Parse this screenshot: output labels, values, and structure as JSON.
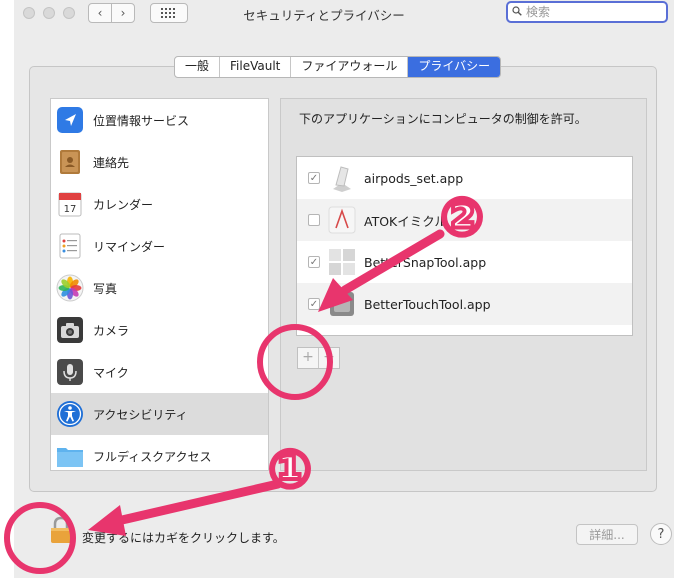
{
  "window": {
    "title": "セキュリティとプライバシー",
    "search_placeholder": "検索"
  },
  "tabs": [
    {
      "label": "一般",
      "active": false
    },
    {
      "label": "FileVault",
      "active": false
    },
    {
      "label": "ファイアウォール",
      "active": false
    },
    {
      "label": "プライバシー",
      "active": true
    }
  ],
  "sidebar": {
    "items": [
      {
        "label": "位置情報サービス",
        "icon": "location-arrow-icon"
      },
      {
        "label": "連絡先",
        "icon": "contacts-book-icon"
      },
      {
        "label": "カレンダー",
        "icon": "calendar-icon"
      },
      {
        "label": "リマインダー",
        "icon": "reminders-icon"
      },
      {
        "label": "写真",
        "icon": "photos-icon"
      },
      {
        "label": "カメラ",
        "icon": "camera-icon"
      },
      {
        "label": "マイク",
        "icon": "microphone-icon"
      },
      {
        "label": "アクセシビリティ",
        "icon": "accessibility-icon",
        "selected": true
      },
      {
        "label": "フルディスクアクセス",
        "icon": "folder-icon"
      }
    ]
  },
  "panel": {
    "instruction": "下のアプリケーションにコンピュータの制御を許可。",
    "apps": [
      {
        "name": "airpods_set.app",
        "checked": true
      },
      {
        "name": "ATOKイミクル",
        "checked": false
      },
      {
        "name": "BetterSnapTool.app",
        "checked": true
      },
      {
        "name": "BetterTouchTool.app",
        "checked": true
      }
    ],
    "add_label": "+",
    "remove_label": "−"
  },
  "footer": {
    "lock_text": "変更するにはカギをクリックします。",
    "details_label": "詳細...",
    "help_label": "?"
  },
  "annotations": {
    "one": "①",
    "two": "②",
    "color": "#e8356d"
  },
  "colors": {
    "accent": "#3b6ee0",
    "lock": "#e9a33b"
  }
}
